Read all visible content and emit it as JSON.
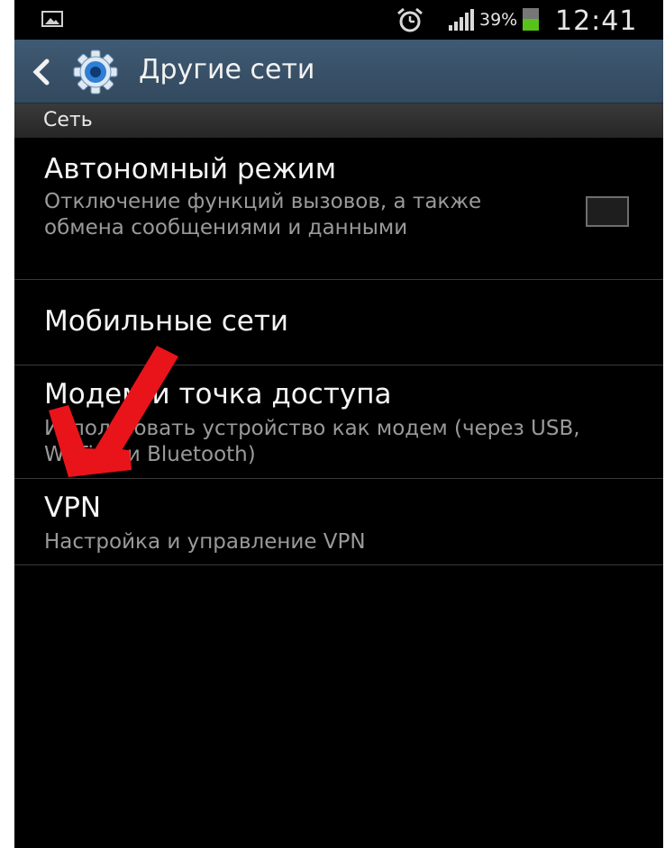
{
  "status_bar": {
    "battery_percent": "39%",
    "time": "12:41",
    "icons": [
      "image-notification-icon",
      "alarm-icon",
      "signal-icon",
      "battery-icon"
    ],
    "battery_level": 0.39
  },
  "action_bar": {
    "title": "Другие сети",
    "icons": [
      "back-icon",
      "settings-gear-icon"
    ]
  },
  "section": {
    "header": "Сеть"
  },
  "items": [
    {
      "title": "Автономный режим",
      "subtitle": "Отключение функций вызовов, а также обмена сообщениями и данными",
      "checked": false
    },
    {
      "title": "Мобильные сети"
    },
    {
      "title": "Модем и точка доступа",
      "subtitle": "Использовать устройство как модем (через USB, Wi-Fi или Bluetooth)"
    },
    {
      "title": "VPN",
      "subtitle": "Настройка и управление VPN"
    }
  ],
  "colors": {
    "action_bar": "#3a5269",
    "background": "#000000",
    "subtitle_text": "#9a9a9a",
    "battery_fill": "#57c21a",
    "annotation_arrow": "#e8141a"
  }
}
